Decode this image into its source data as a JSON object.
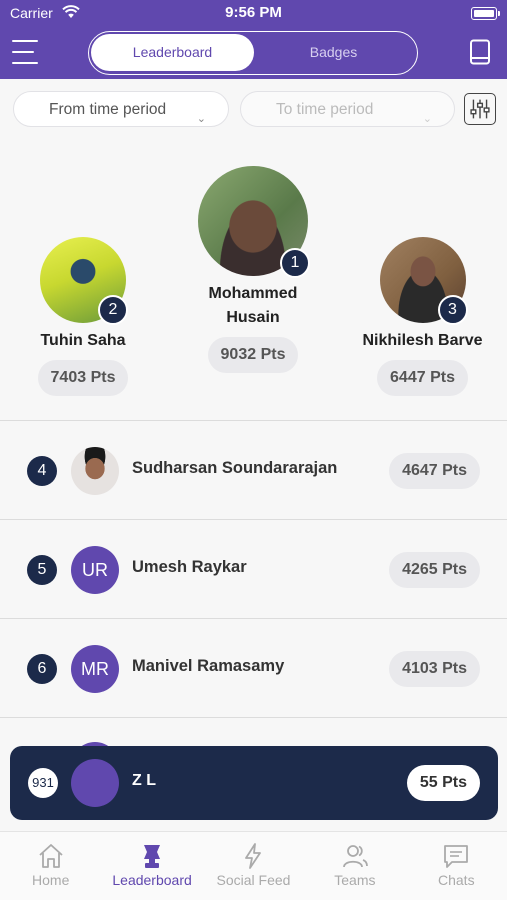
{
  "status": {
    "carrier": "Carrier",
    "time": "9:56 PM"
  },
  "header": {
    "tabs": [
      "Leaderboard",
      "Badges"
    ]
  },
  "filters": {
    "from_placeholder": "From time period",
    "to_placeholder": "To time period"
  },
  "podium": [
    {
      "rank": "1",
      "name_line1": "Mohammed",
      "name_line2": "Husain",
      "points": "9032 Pts"
    },
    {
      "rank": "2",
      "name": "Tuhin Saha",
      "points": "7403 Pts"
    },
    {
      "rank": "3",
      "name": "Nikhilesh Barve",
      "points": "6447 Pts"
    }
  ],
  "list": [
    {
      "rank": "4",
      "initials": "",
      "name": "Sudharsan Soundararajan",
      "points": "4647 Pts"
    },
    {
      "rank": "5",
      "initials": "UR",
      "name": "Umesh Raykar",
      "points": "4265 Pts"
    },
    {
      "rank": "6",
      "initials": "MR",
      "name": "Manivel Ramasamy",
      "points": "4103 Pts"
    }
  ],
  "me": {
    "rank": "931",
    "name": "Z L",
    "points": "55 Pts"
  },
  "tabbar": {
    "items": [
      {
        "label": "Home",
        "icon": "home-icon"
      },
      {
        "label": "Leaderboard",
        "icon": "trophy-icon"
      },
      {
        "label": "Social Feed",
        "icon": "lightning-icon"
      },
      {
        "label": "Teams",
        "icon": "people-icon"
      },
      {
        "label": "Chats",
        "icon": "chat-icon"
      }
    ]
  },
  "colors": {
    "primary": "#6048ae",
    "navy": "#1c2a4a",
    "pill": "#e9e9ec"
  }
}
